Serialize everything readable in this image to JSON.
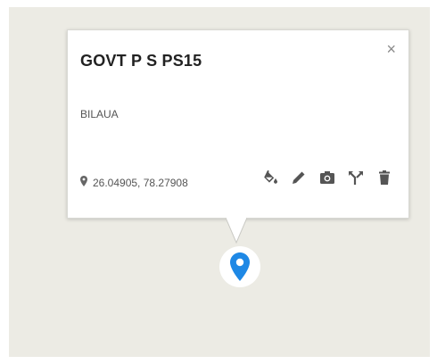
{
  "popup": {
    "title": "GOVT P S PS15",
    "close_label": "×",
    "subtitle": "BILAUA",
    "coordinates": "26.04905, 78.27908"
  },
  "icons": {
    "location": "location-pin-icon",
    "fill": "paint-bucket-icon",
    "edit": "pencil-icon",
    "photo": "camera-icon",
    "directions": "directions-fork-icon",
    "delete": "trash-icon",
    "marker": "map-marker-icon"
  },
  "colors": {
    "map_background": "#ecebe4",
    "marker_blue": "#1e88e5",
    "icon_gray": "#555555"
  }
}
